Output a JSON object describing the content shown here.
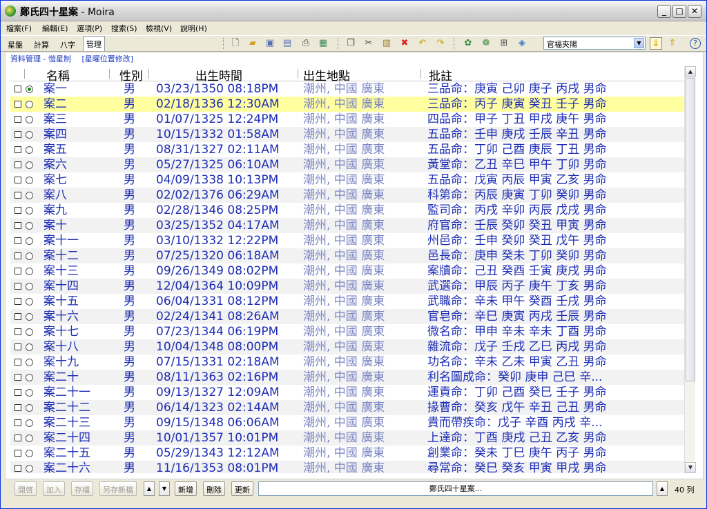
{
  "window": {
    "title": "鄭氏四十星案",
    "app": " - Moira",
    "min_label": "_",
    "max_label": "□",
    "close_label": "✕"
  },
  "menu": [
    "檔案(F)",
    "編輯(E)",
    "選項(P)",
    "搜索(S)",
    "檢視(V)",
    "說明(H)"
  ],
  "tabs": [
    "星盤",
    "計算",
    "八字",
    "管理"
  ],
  "toolbar_icons": [
    "new-icon",
    "open-icon",
    "save-icon",
    "save-as-icon",
    "print-icon",
    "print-preview-icon",
    "copy-icon",
    "cut-icon",
    "paste-icon",
    "delete-icon",
    "undo-icon",
    "redo-icon",
    "chart-icon",
    "chart-settings-icon",
    "grid-icon",
    "palette-icon"
  ],
  "combo": {
    "value": "官福夾陽"
  },
  "subnav": [
    "資料管理 - 愷星制",
    "[星曜位置修改]"
  ],
  "columns": [
    "名稱",
    "性別",
    "出生時間",
    "出生地點",
    "批註"
  ],
  "rows": [
    {
      "name": "案一",
      "sex": "男",
      "time": "03/23/1350 08:18PM",
      "place": "潮州, 中國 廣東",
      "note": "三品命：庚寅 己卯 庚子 丙戌 男命"
    },
    {
      "name": "案二",
      "sex": "男",
      "time": "02/18/1336 12:30AM",
      "place": "潮州, 中國 廣東",
      "note": "三品命：丙子 庚寅 癸丑 壬子 男命"
    },
    {
      "name": "案三",
      "sex": "男",
      "time": "01/07/1325 12:24PM",
      "place": "潮州, 中國 廣東",
      "note": "四品命：甲子 丁丑 甲戌 庚午 男命"
    },
    {
      "name": "案四",
      "sex": "男",
      "time": "10/15/1332 01:58AM",
      "place": "潮州, 中國 廣東",
      "note": "五品命：壬申 庚戌 壬辰 辛丑 男命"
    },
    {
      "name": "案五",
      "sex": "男",
      "time": "08/31/1327 02:11AM",
      "place": "潮州, 中國 廣東",
      "note": "五品命：丁卯 己酉 庚辰 丁丑 男命"
    },
    {
      "name": "案六",
      "sex": "男",
      "time": "05/27/1325 06:10AM",
      "place": "潮州, 中國 廣東",
      "note": "黃堂命：乙丑 辛巳 甲午 丁卯 男命"
    },
    {
      "name": "案七",
      "sex": "男",
      "time": "04/09/1338 10:13PM",
      "place": "潮州, 中國 廣東",
      "note": "五品命：戊寅 丙辰 甲寅 乙亥 男命"
    },
    {
      "name": "案八",
      "sex": "男",
      "time": "02/02/1376 06:29AM",
      "place": "潮州, 中國 廣東",
      "note": "科第命：丙辰 庚寅 丁卯 癸卯 男命"
    },
    {
      "name": "案九",
      "sex": "男",
      "time": "02/28/1346 08:25PM",
      "place": "潮州, 中國 廣東",
      "note": "監司命：丙戌 辛卯 丙辰 戊戌 男命"
    },
    {
      "name": "案十",
      "sex": "男",
      "time": "03/25/1352 04:17AM",
      "place": "潮州, 中國 廣東",
      "note": "府官命：壬辰 癸卯 癸丑 甲寅 男命"
    },
    {
      "name": "案十一",
      "sex": "男",
      "time": "03/10/1332 12:22PM",
      "place": "潮州, 中國 廣東",
      "note": "州邑命：壬申 癸卯 癸丑 戊午 男命"
    },
    {
      "name": "案十二",
      "sex": "男",
      "time": "07/25/1320 06:18AM",
      "place": "潮州, 中國 廣東",
      "note": "邑長命：庚申 癸未 丁卯 癸卯 男命"
    },
    {
      "name": "案十三",
      "sex": "男",
      "time": "09/26/1349 08:02PM",
      "place": "潮州, 中國 廣東",
      "note": "案牘命：己丑 癸酉 壬寅 庚戌 男命"
    },
    {
      "name": "案十四",
      "sex": "男",
      "time": "12/04/1364 10:09PM",
      "place": "潮州, 中國 廣東",
      "note": "武選命：甲辰 丙子 庚午 丁亥 男命"
    },
    {
      "name": "案十五",
      "sex": "男",
      "time": "06/04/1331 08:12PM",
      "place": "潮州, 中國 廣東",
      "note": "武職命：辛未 甲午 癸酉 壬戌 男命"
    },
    {
      "name": "案十六",
      "sex": "男",
      "time": "02/24/1341 08:26AM",
      "place": "潮州, 中國 廣東",
      "note": "官皂命：辛巳 庚寅 丙戌 壬辰 男命"
    },
    {
      "name": "案十七",
      "sex": "男",
      "time": "07/23/1344 06:19PM",
      "place": "潮州, 中國 廣東",
      "note": "微名命：甲申 辛未 辛未 丁酉 男命"
    },
    {
      "name": "案十八",
      "sex": "男",
      "time": "10/04/1348 08:00PM",
      "place": "潮州, 中國 廣東",
      "note": "雜流命：戊子 壬戌 乙巳 丙戌 男命"
    },
    {
      "name": "案十九",
      "sex": "男",
      "time": "07/15/1331 02:18AM",
      "place": "潮州, 中國 廣東",
      "note": "功名命：辛未 乙未 甲寅 乙丑 男命"
    },
    {
      "name": "案二十",
      "sex": "男",
      "time": "08/11/1363 02:16PM",
      "place": "潮州, 中國 廣東",
      "note": "利名圖成命：癸卯 庚申 己巳 辛..."
    },
    {
      "name": "案二十一",
      "sex": "男",
      "time": "09/13/1327 12:09AM",
      "place": "潮州, 中國 廣東",
      "note": "運責命：丁卯 己酉 癸巳 壬子 男命"
    },
    {
      "name": "案二十二",
      "sex": "男",
      "time": "06/14/1323 02:14AM",
      "place": "潮州, 中國 廣東",
      "note": "掾曹命：癸亥 戊午 辛丑 己丑 男命"
    },
    {
      "name": "案二十三",
      "sex": "男",
      "time": "09/15/1348 06:06AM",
      "place": "潮州, 中國 廣東",
      "note": "貴而帶疾命：戊子 辛酉 丙戌 辛..."
    },
    {
      "name": "案二十四",
      "sex": "男",
      "time": "10/01/1357 10:01PM",
      "place": "潮州, 中國 廣東",
      "note": "上達命：丁酉 庚戌 己丑 乙亥 男命"
    },
    {
      "name": "案二十五",
      "sex": "男",
      "time": "05/29/1343 12:12AM",
      "place": "潮州, 中國 廣東",
      "note": "創業命：癸未 丁巳 庚午 丙子 男命"
    },
    {
      "name": "案二十六",
      "sex": "男",
      "time": "11/16/1353 08:01PM",
      "place": "潮州, 中國 廣東",
      "note": "尋常命：癸巳 癸亥 甲寅 甲戌 男命"
    }
  ],
  "bottom": {
    "buttons_disabled": [
      "開啓",
      "加入",
      "存檔",
      "另存新檔"
    ],
    "buttons": [
      "新增",
      "刪除",
      "更新"
    ],
    "name_value": "鄭氏四十星案...",
    "count": "40 列"
  },
  "colors": {
    "selected_row": "#ffffa0",
    "text": "#1c2db5",
    "place": "#7c86c4"
  }
}
